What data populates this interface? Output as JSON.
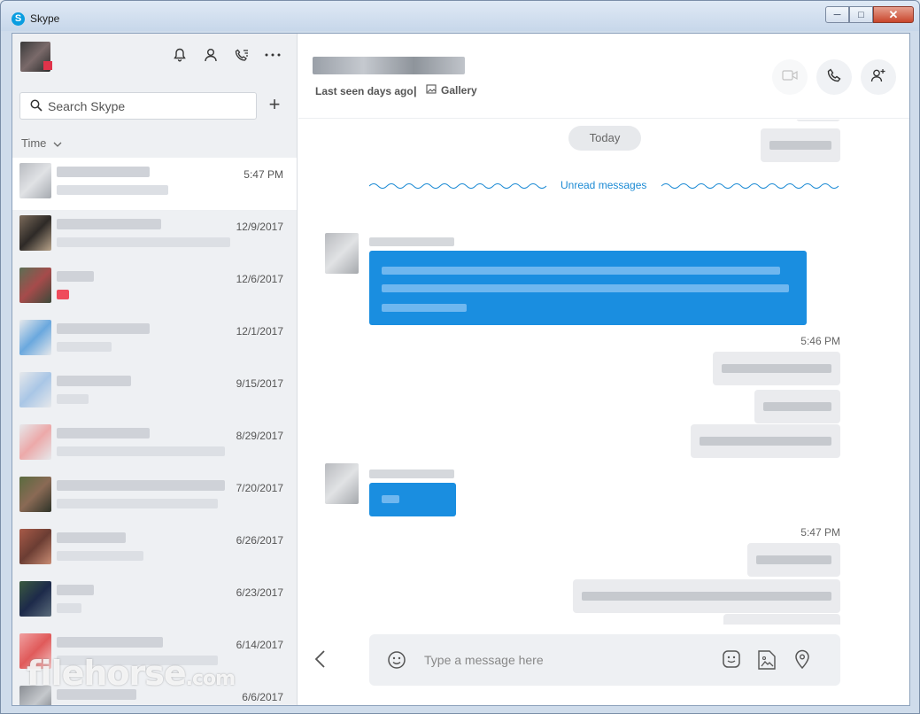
{
  "window": {
    "title": "Skype"
  },
  "sidebar": {
    "search_placeholder": "Search Skype",
    "sort_label": "Time",
    "conversations": [
      {
        "date": "5:47 PM",
        "active": true
      },
      {
        "date": "12/9/2017"
      },
      {
        "date": "12/6/2017"
      },
      {
        "date": "12/1/2017"
      },
      {
        "date": "9/15/2017"
      },
      {
        "date": "8/29/2017"
      },
      {
        "date": "7/20/2017"
      },
      {
        "date": "6/26/2017"
      },
      {
        "date": "6/23/2017"
      },
      {
        "date": "6/14/2017"
      },
      {
        "date": "6/6/2017"
      }
    ],
    "watermark": "filehorse",
    "watermark_suffix": ".com"
  },
  "chat": {
    "last_seen": "Last seen days ago",
    "separator": "|",
    "gallery_label": "Gallery",
    "today_label": "Today",
    "unread_label": "Unread messages",
    "timestamp_1": "5:46 PM",
    "timestamp_2": "5:47 PM",
    "composer_placeholder": "Type a message here"
  },
  "colors": {
    "accent": "#1a8ee0",
    "sidebar_bg": "#eef0f3",
    "status_busy": "#e0334a"
  },
  "icons": [
    "skype-logo-icon",
    "bell-icon",
    "contacts-icon",
    "call-history-icon",
    "more-icon",
    "search-icon",
    "plus-icon",
    "chevron-down-icon",
    "gallery-icon",
    "video-call-icon",
    "audio-call-icon",
    "add-person-icon",
    "back-arrow-icon",
    "emoji-icon",
    "sticker-icon",
    "image-icon",
    "location-icon"
  ]
}
